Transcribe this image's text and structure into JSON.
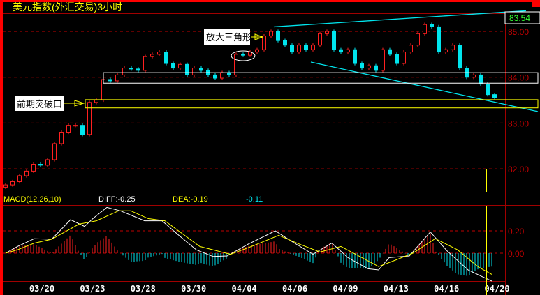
{
  "title": "美元指数(外汇交易)3小时",
  "colors": {
    "up": "#ff2020",
    "down": "#00e5ee",
    "grid": "#c00000",
    "diff": "#ffffff",
    "dea": "#ffff00",
    "trendline": "#00e5ee"
  },
  "chart_data": [
    {
      "type": "candlestick",
      "title": "美元指数(外汇交易)3小时",
      "ylim": [
        81.5,
        85.4
      ],
      "yticks": [
        "85.00",
        "84.00",
        "83.00",
        "82.00"
      ],
      "last_price": "83.54",
      "xticks": [
        "03/20",
        "03/23",
        "03/28",
        "03/30",
        "04/04",
        "04/06",
        "04/09",
        "04/13",
        "04/16",
        "04/20"
      ],
      "close": [
        81.65,
        81.72,
        81.85,
        81.95,
        82.1,
        82.08,
        82.2,
        82.55,
        82.8,
        82.95,
        82.95,
        82.75,
        83.45,
        83.5,
        83.95,
        83.92,
        84.05,
        84.2,
        84.18,
        84.15,
        84.45,
        84.5,
        84.55,
        84.3,
        84.2,
        84.28,
        84.05,
        84.2,
        84.15,
        84.05,
        83.98,
        84.1,
        84.05,
        84.5,
        84.48,
        84.55,
        84.6,
        84.9,
        85.0,
        84.8,
        84.7,
        84.55,
        84.7,
        84.6,
        84.7,
        84.95,
        85.0,
        84.6,
        84.55,
        84.6,
        84.3,
        84.2,
        84.25,
        84.15,
        84.6,
        84.5,
        84.3,
        84.55,
        84.7,
        84.95,
        85.15,
        85.1,
        84.55,
        84.6,
        84.7,
        84.2,
        84.0,
        84.05,
        83.85,
        83.62,
        83.56
      ],
      "annotations": {
        "triangle_label": "放大三角形",
        "breakout_label": "前期突破口",
        "upper_trendline": [
          [
            38.4,
            85.1
          ],
          [
            74.5,
            85.45
          ]
        ],
        "lower_trendline": [
          [
            43.7,
            84.33
          ],
          [
            76.2,
            83.25
          ]
        ],
        "white_box": [
          84.1,
          83.87
        ],
        "yellow_box": [
          83.51,
          83.33
        ]
      }
    },
    {
      "type": "line",
      "title": "MACD(12,26,10)",
      "diff_label": "DIFF:-0.25",
      "dea_label": "DEA:-0.19",
      "macd_label": "-0.11",
      "yticks": [
        "0.20",
        "0.00"
      ],
      "diff": [
        [
          0,
          0
        ],
        [
          1.7,
          0.06
        ],
        [
          4.1,
          0.13
        ],
        [
          6.6,
          0.125
        ],
        [
          9.3,
          0.3
        ],
        [
          11.3,
          0.24
        ],
        [
          12.5,
          0.31
        ],
        [
          14.5,
          0.41
        ],
        [
          16.4,
          0.38
        ],
        [
          19.9,
          0.29
        ],
        [
          22.4,
          0.29
        ],
        [
          24.8,
          0.16
        ],
        [
          27.3,
          0.03
        ],
        [
          29.7,
          -0.03
        ],
        [
          31.7,
          -0.025
        ],
        [
          34.7,
          0.08
        ],
        [
          38.6,
          0.2
        ],
        [
          41.1,
          0.1
        ],
        [
          44,
          -0.01
        ],
        [
          46.7,
          0.09
        ],
        [
          49,
          -0.04
        ],
        [
          51.9,
          -0.14
        ],
        [
          53.4,
          -0.15
        ],
        [
          54.9,
          -0.04
        ],
        [
          57.8,
          -0.025
        ],
        [
          60.8,
          0.19
        ],
        [
          63.2,
          0.02
        ],
        [
          66.2,
          -0.15
        ],
        [
          68.2,
          -0.21
        ],
        [
          69.6,
          -0.25
        ]
      ],
      "dea": [
        [
          0,
          0
        ],
        [
          1.7,
          0.03
        ],
        [
          4.1,
          0.09
        ],
        [
          6.6,
          0.125
        ],
        [
          10.5,
          0.26
        ],
        [
          13,
          0.29
        ],
        [
          16.2,
          0.38
        ],
        [
          17.9,
          0.38
        ],
        [
          20.4,
          0.31
        ],
        [
          22.8,
          0.29
        ],
        [
          27.8,
          0.06
        ],
        [
          32.2,
          -0.01
        ],
        [
          35.2,
          0.06
        ],
        [
          39.1,
          0.16
        ],
        [
          42.1,
          0.08
        ],
        [
          45,
          0.01
        ],
        [
          48,
          0.06
        ],
        [
          53.4,
          -0.12
        ],
        [
          55.9,
          -0.06
        ],
        [
          58.3,
          0
        ],
        [
          61.5,
          0.13
        ],
        [
          64.7,
          0.03
        ],
        [
          67.7,
          -0.125
        ],
        [
          69.6,
          -0.19
        ]
      ]
    }
  ]
}
